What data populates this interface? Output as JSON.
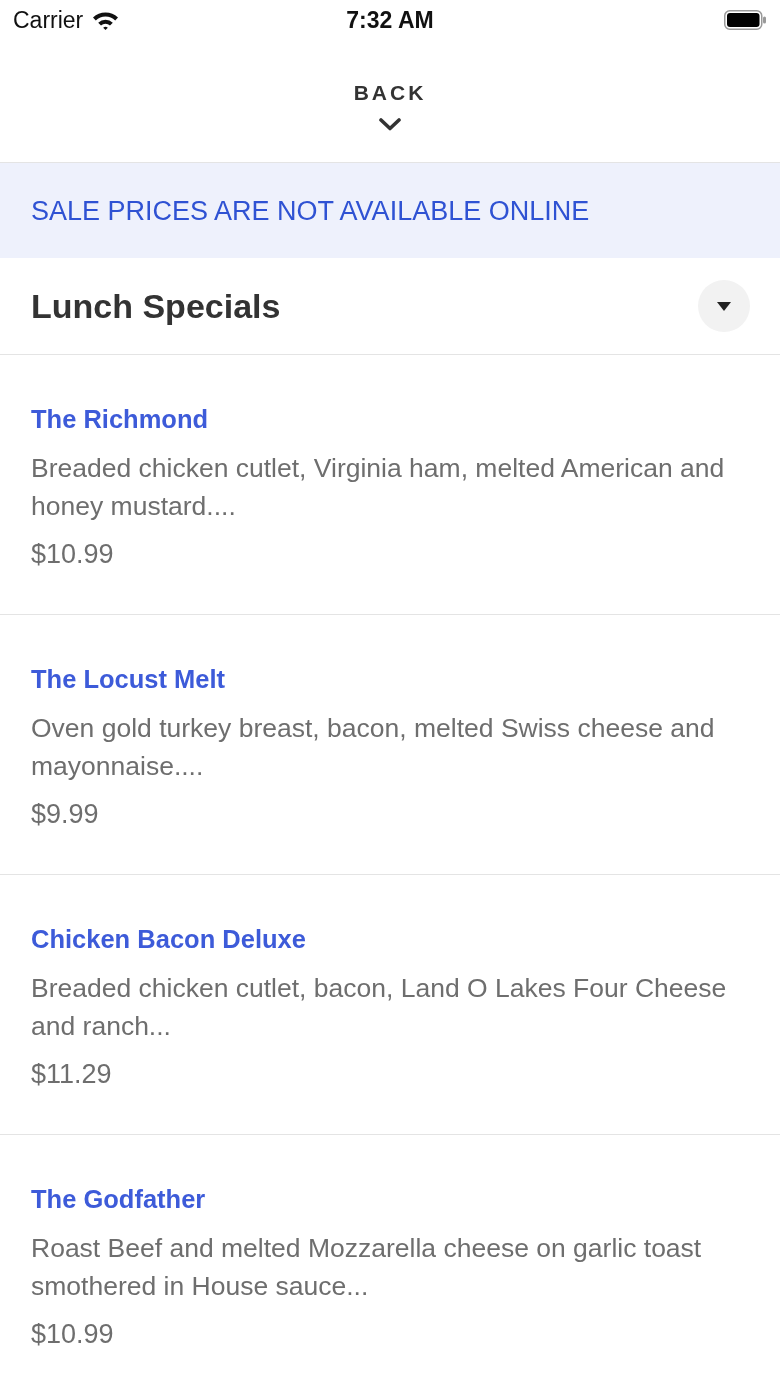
{
  "status_bar": {
    "carrier": "Carrier",
    "time": "7:32 AM"
  },
  "header": {
    "back_label": "BACK"
  },
  "banner": {
    "text": "SALE PRICES ARE NOT AVAILABLE ONLINE"
  },
  "section": {
    "title": "Lunch Specials",
    "expanded": true
  },
  "items": [
    {
      "name": "The Richmond",
      "description": "Breaded chicken cutlet, Virginia ham, melted American and honey mustard....",
      "price": "$10.99"
    },
    {
      "name": "The Locust Melt",
      "description": "Oven gold turkey breast, bacon, melted Swiss cheese and mayonnaise....",
      "price": "$9.99"
    },
    {
      "name": "Chicken Bacon Deluxe",
      "description": "Breaded chicken cutlet, bacon, Land O Lakes Four Cheese and ranch...",
      "price": "$11.29"
    },
    {
      "name": "The Godfather",
      "description": "Roast Beef and melted Mozzarella cheese on garlic toast smothered in House sauce...",
      "price": "$10.99"
    }
  ]
}
